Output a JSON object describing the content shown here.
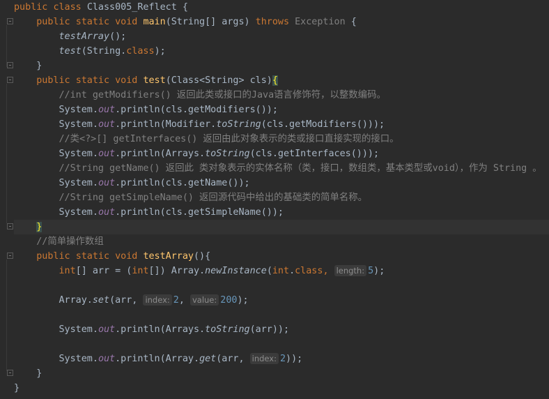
{
  "editor": {
    "language": "Java",
    "class_decl": {
      "kw1": "public",
      "kw2": "class",
      "name": "Class005_Reflect",
      "brace": "{"
    },
    "main": {
      "sig": {
        "k1": "public",
        "k2": "static",
        "k3": "void",
        "name": "main",
        "params": "(String[] args) ",
        "throws": "throws",
        "exc": "Exception",
        "brace": "{"
      },
      "l1": {
        "call": "testArray",
        "rest": "();"
      },
      "l2": {
        "call": "test",
        "a": "(String.",
        "kw": "class",
        "b": ");"
      },
      "close": "}"
    },
    "test": {
      "sig": {
        "k1": "public",
        "k2": "static",
        "k3": "void",
        "name": "test",
        "params": "(Class<String> cls)",
        "brace": "{"
      },
      "c1": "//int getModifiers() 返回此类或接口的Java语言修饰符，以整数编码。",
      "s1": {
        "a": "System.",
        "out": "out",
        "b": ".println(cls.getModifiers());"
      },
      "s2": {
        "a": "System.",
        "out": "out",
        "b": ".println(Modifier.",
        "m": "toString",
        "c": "(cls.getModifiers()));"
      },
      "c2": "//类<?>[] getInterfaces() 返回由此对象表示的类或接口直接实现的接口。",
      "s3": {
        "a": "System.",
        "out": "out",
        "b": ".println(Arrays.",
        "m": "toString",
        "c": "(cls.getInterfaces()));"
      },
      "c3": "//String getName() 返回此 类对象表示的实体名称（类，接口，数组类，基本类型或void），作为 String 。",
      "s4": {
        "a": "System.",
        "out": "out",
        "b": ".println(cls.getName());"
      },
      "c4": "//String getSimpleName() 返回源代码中给出的基础类的简单名称。",
      "s5": {
        "a": "System.",
        "out": "out",
        "b": ".println(cls.getSimpleName());"
      },
      "close": "}"
    },
    "testArray": {
      "comment": "//简单操作数组",
      "sig": {
        "k1": "public",
        "k2": "static",
        "k3": "void",
        "name": "testArray",
        "params": "(){"
      },
      "l1": {
        "t": "int",
        "a": "[] arr = (",
        "t2": "int",
        "b": "[]) Array.",
        "m": "newInstance",
        "c": "(",
        "t3": "int",
        ".": ".",
        "kw": "class",
        ",": ",",
        "hint": "length:",
        "num": "5",
        "end": ");"
      },
      "l2": {
        "a": "Array.",
        "m": "set",
        "b": "(arr,",
        "hint1": "index:",
        "n1": "2",
        ",": ",",
        "hint2": "value:",
        "n2": "200",
        "end": ");"
      },
      "l3": {
        "a": "System.",
        "out": "out",
        "b": ".println(Arrays.",
        "m": "toString",
        "c": "(arr));"
      },
      "l4": {
        "a": "System.",
        "out": "out",
        "b": ".println(Array.",
        "m": "get",
        "c": "(arr,",
        "hint": "index:",
        "n": "2",
        "end": "));"
      },
      "close": "}"
    },
    "class_close": "}"
  }
}
